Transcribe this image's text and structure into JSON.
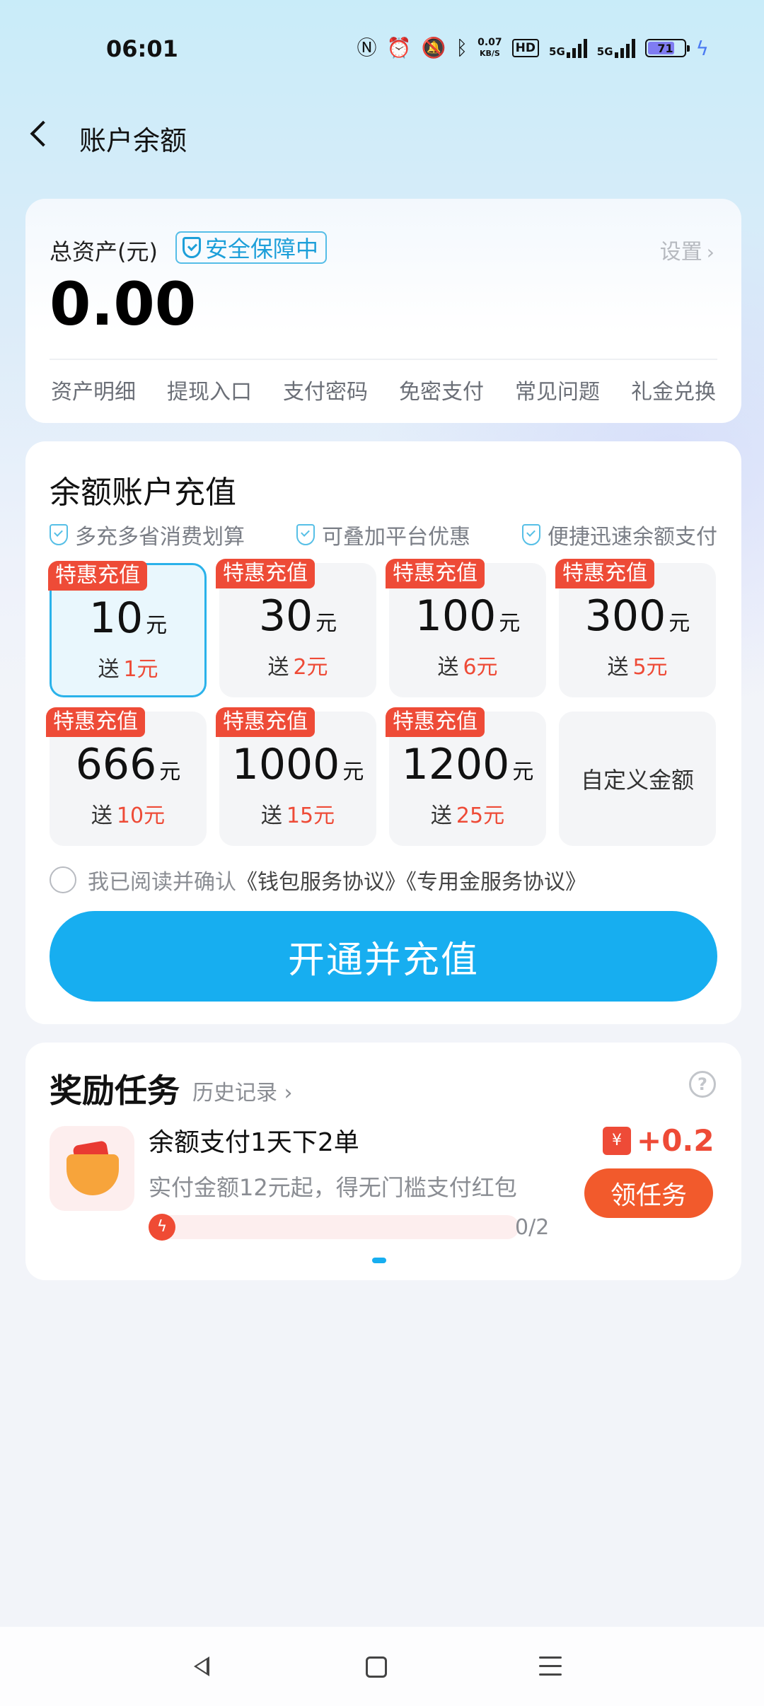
{
  "status_bar": {
    "time": "06:01",
    "icons": [
      "nfc-icon",
      "alarm-icon",
      "mute-icon",
      "bluetooth-icon",
      "net-speed",
      "hd-icon",
      "5g-signal-icon",
      "5g-signal-icon",
      "battery-icon",
      "charging-icon"
    ],
    "net_speed_value": "0.07",
    "net_speed_unit": "KB/S",
    "hd_label": "HD",
    "sim1_label": "5G",
    "sim2_label": "5G",
    "battery_level": "71"
  },
  "header": {
    "title": "账户余额"
  },
  "account_card": {
    "assets_label": "总资产(元)",
    "secure_label": "安全保障中",
    "settings_label": "设置",
    "balance": "0.00",
    "quick_links": [
      "资产明细",
      "提现入口",
      "支付密码",
      "免密支付",
      "常见问题",
      "礼金兑换"
    ]
  },
  "recharge": {
    "title": "余额账户充值",
    "features": [
      "多充多省消费划算",
      "可叠加平台优惠",
      "便捷迅速余额支付"
    ],
    "options": [
      {
        "tag": "特惠充值",
        "amount": "10",
        "unit": "元",
        "bonus_prefix": "送",
        "bonus": "1元",
        "selected": true
      },
      {
        "tag": "特惠充值",
        "amount": "30",
        "unit": "元",
        "bonus_prefix": "送",
        "bonus": "2元",
        "selected": false
      },
      {
        "tag": "特惠充值",
        "amount": "100",
        "unit": "元",
        "bonus_prefix": "送",
        "bonus": "6元",
        "selected": false
      },
      {
        "tag": "特惠充值",
        "amount": "300",
        "unit": "元",
        "bonus_prefix": "送",
        "bonus": "5元",
        "selected": false
      },
      {
        "tag": "特惠充值",
        "amount": "666",
        "unit": "元",
        "bonus_prefix": "送",
        "bonus": "10元",
        "selected": false
      },
      {
        "tag": "特惠充值",
        "amount": "1000",
        "unit": "元",
        "bonus_prefix": "送",
        "bonus": "15元",
        "selected": false
      },
      {
        "tag": "特惠充值",
        "amount": "1200",
        "unit": "元",
        "bonus_prefix": "送",
        "bonus": "25元",
        "selected": false
      }
    ],
    "custom_label": "自定义金额",
    "agreement_prefix": "我已阅读并确认",
    "agreement_links": "《钱包服务协议》《专用金服务协议》",
    "submit_label": "开通并充值"
  },
  "rewards": {
    "title": "奖励任务",
    "history_label": "历史记录",
    "task": {
      "name": "余额支付1天下2单",
      "description": "实付金额12元起，得无门槛支付红包",
      "progress_text": "0/2",
      "progress_fraction": 0,
      "reward": "+0.2",
      "reward_currency": "¥",
      "claim_label": "领任务"
    }
  },
  "colors": {
    "accent_blue": "#17aef0",
    "promo_red": "#ee4b37",
    "claim_orange": "#f25a2c"
  }
}
